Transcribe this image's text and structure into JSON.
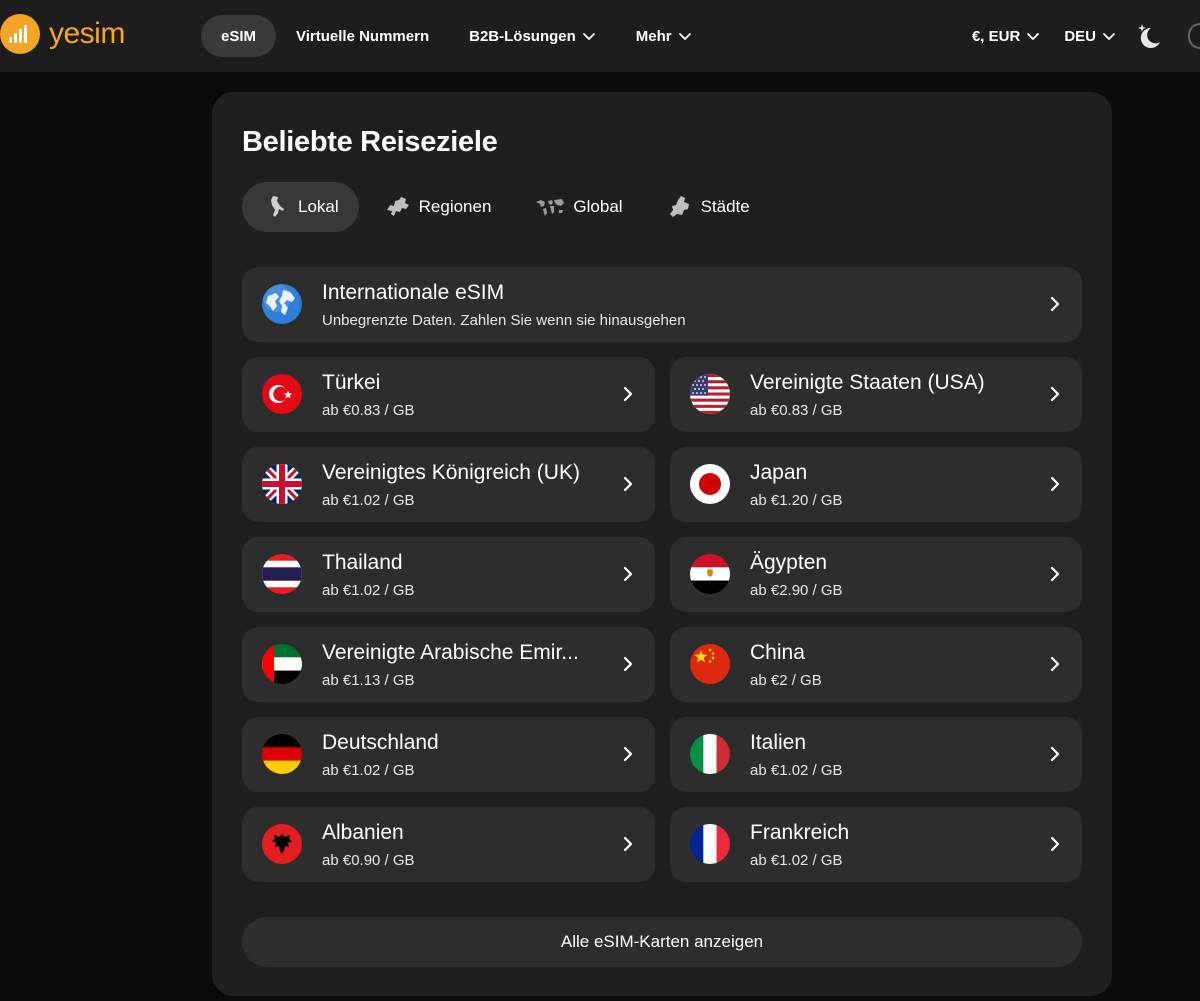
{
  "header": {
    "logo_text": "yesim",
    "nav": [
      {
        "label": "eSIM",
        "active": true,
        "dropdown": false
      },
      {
        "label": "Virtuelle Nummern",
        "active": false,
        "dropdown": false
      },
      {
        "label": "B2B-Lösungen",
        "active": false,
        "dropdown": true
      },
      {
        "label": "Mehr",
        "active": false,
        "dropdown": true
      }
    ],
    "currency": "€, EUR",
    "language": "DEU",
    "theme_icon": "moon-stars-icon"
  },
  "panel": {
    "title": "Beliebte Reiseziele",
    "tabs": [
      {
        "label": "Lokal",
        "icon": "italy-map-icon",
        "active": true
      },
      {
        "label": "Regionen",
        "icon": "europe-map-icon",
        "active": false
      },
      {
        "label": "Global",
        "icon": "world-map-icon",
        "active": false
      },
      {
        "label": "Städte",
        "icon": "city-map-icon",
        "active": false
      }
    ],
    "featured": {
      "name": "Internationale eSIM",
      "description": "Unbegrenzte Daten. Zahlen Sie wenn sie hinausgehen",
      "icon": "globe-icon"
    },
    "destinations": [
      {
        "name": "Türkei",
        "price": "ab €0.83 / GB",
        "flag": "turkey-flag-icon"
      },
      {
        "name": "Vereinigte Staaten (USA)",
        "price": "ab €0.83 / GB",
        "flag": "usa-flag-icon"
      },
      {
        "name": "Vereinigtes Königreich (UK)",
        "price": "ab €1.02 / GB",
        "flag": "uk-flag-icon"
      },
      {
        "name": "Japan",
        "price": "ab €1.20 / GB",
        "flag": "japan-flag-icon"
      },
      {
        "name": "Thailand",
        "price": "ab €1.02 / GB",
        "flag": "thailand-flag-icon"
      },
      {
        "name": "Ägypten",
        "price": "ab €2.90 / GB",
        "flag": "egypt-flag-icon"
      },
      {
        "name": "Vereinigte Arabische Emir...",
        "price": "ab €1.13 / GB",
        "flag": "uae-flag-icon"
      },
      {
        "name": "China",
        "price": "ab €2 / GB",
        "flag": "china-flag-icon"
      },
      {
        "name": "Deutschland",
        "price": "ab €1.02 / GB",
        "flag": "germany-flag-icon"
      },
      {
        "name": "Italien",
        "price": "ab €1.02 / GB",
        "flag": "italy-flag-icon"
      },
      {
        "name": "Albanien",
        "price": "ab €0.90 / GB",
        "flag": "albania-flag-icon"
      },
      {
        "name": "Frankreich",
        "price": "ab €1.02 / GB",
        "flag": "france-flag-icon"
      }
    ],
    "show_all_label": "Alle eSIM-Karten anzeigen"
  },
  "colors": {
    "brand": "#f5a524",
    "page_bg": "#0b0b0b",
    "header_bg": "#1d1d1d",
    "panel_bg": "#1f1f1f",
    "card_bg": "#2d2d2d",
    "active_pill": "#383838"
  }
}
